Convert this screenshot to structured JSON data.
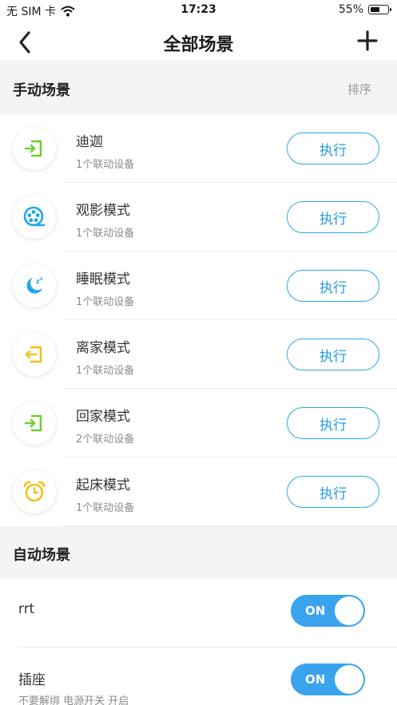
{
  "status_bar": {
    "carrier": "无 SIM 卡",
    "time": "17:23",
    "battery": "55%",
    "battery_level": 0.55
  },
  "nav": {
    "title": "全部场景",
    "back_icon": "chevron-left-icon",
    "add_icon": "plus-icon"
  },
  "manual": {
    "title": "手动场景",
    "sort_label": "排序",
    "exec_label": "执行",
    "scenes": [
      {
        "name": "迪迦",
        "sub": "1个联动设备",
        "icon": "enter-door-icon",
        "color": "#6fcf2f"
      },
      {
        "name": "观影模式",
        "sub": "1个联动设备",
        "icon": "film-reel-icon",
        "color": "#1fa6e8"
      },
      {
        "name": "睡眠模式",
        "sub": "1个联动设备",
        "icon": "moon-sleep-icon",
        "color": "#1fa6e8"
      },
      {
        "name": "离家模式",
        "sub": "1个联动设备",
        "icon": "leave-door-icon",
        "color": "#f2c21b"
      },
      {
        "name": "回家模式",
        "sub": "2个联动设备",
        "icon": "enter-door-icon",
        "color": "#6fcf2f"
      },
      {
        "name": "起床模式",
        "sub": "1个联动设备",
        "icon": "alarm-clock-icon",
        "color": "#f2c21b"
      }
    ]
  },
  "auto": {
    "title": "自动场景",
    "toggle_label": "ON",
    "accent": "#3aa3ee",
    "scenes": [
      {
        "name": "rrt",
        "sub": "",
        "enabled": true
      },
      {
        "name": "插座",
        "sub": "不要解绑 电源开关 开启",
        "enabled": true
      }
    ]
  }
}
